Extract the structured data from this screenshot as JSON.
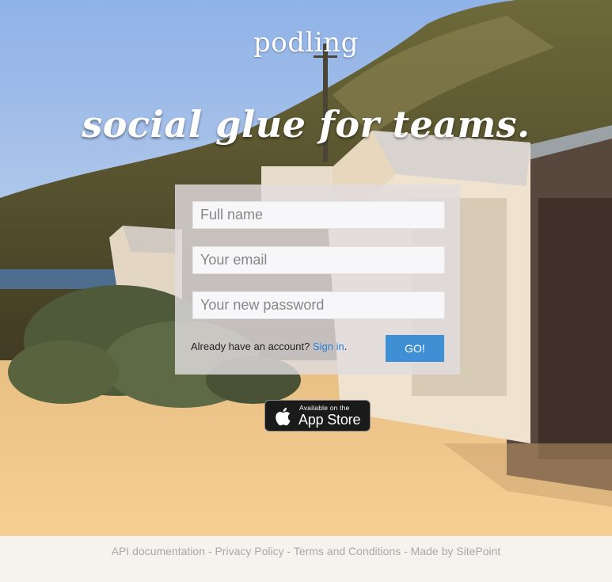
{
  "header": {
    "brand": "podling",
    "tagline": "social glue for teams."
  },
  "signup_form": {
    "full_name_placeholder": "Full name",
    "full_name_value": "",
    "email_placeholder": "Your email",
    "email_value": "",
    "password_placeholder": "Your new password",
    "password_value": "",
    "account_prompt": "Already have an account? ",
    "signin_link": "Sign in",
    "signin_suffix": ".",
    "submit_label": "GO!"
  },
  "app_store_badge": {
    "icon": "apple-icon",
    "line1": "Available on the",
    "line2": "App Store"
  },
  "footer": {
    "links": [
      "API documentation",
      "Privacy Policy",
      "Terms and Conditions",
      "Made by SitePoint"
    ],
    "separator": " - "
  },
  "colors": {
    "button": "#3f8fd4",
    "link": "#2a7fd6",
    "footer_text": "#a9a9a9",
    "footer_bg": "#f6f2ee"
  }
}
